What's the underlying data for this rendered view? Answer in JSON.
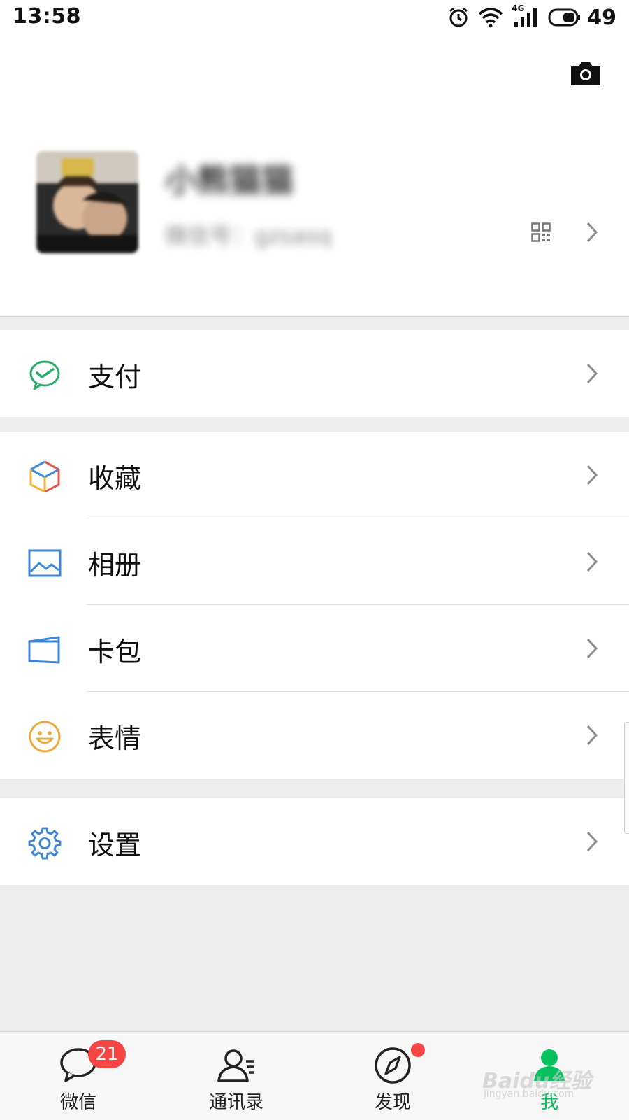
{
  "status_bar": {
    "time": "13:58",
    "network": "4G",
    "battery": "49"
  },
  "profile": {
    "nickname": "小熊猫猫",
    "wechat_id": "微信号：gzsasq",
    "icons": [
      "camera-icon",
      "qrcode-icon",
      "chevron-right-icon"
    ]
  },
  "menu": {
    "pay": "支付",
    "favorites": "收藏",
    "album": "相册",
    "cards": "卡包",
    "stickers": "表情",
    "settings": "设置"
  },
  "tabs": [
    {
      "label": "微信",
      "badge": "21"
    },
    {
      "label": "通讯录"
    },
    {
      "label": "发现",
      "dot": true
    },
    {
      "label": "我",
      "active": true
    }
  ],
  "watermark": {
    "main": "Baidu经验",
    "sub": "jingyan.baidu.com"
  },
  "colors": {
    "accent": "#07c160",
    "badge": "#f54545",
    "background": "#ececec"
  }
}
